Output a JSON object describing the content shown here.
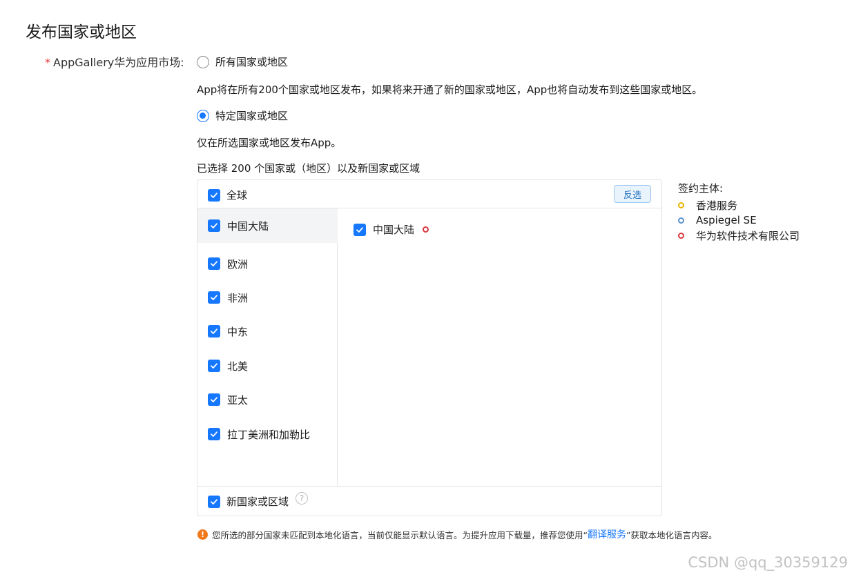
{
  "page": {
    "title": "发布国家或地区"
  },
  "field": {
    "required_mark": "*",
    "label": "AppGallery华为应用市场:"
  },
  "options": {
    "all_label": "所有国家或地区",
    "all_desc": "App将在所有200个国家或地区发布，如果将来开通了新的国家或地区，App也将自动发布到这些国家或地区。",
    "specific_label": "特定国家或地区",
    "specific_desc": "仅在所选国家或地区发布App。",
    "selected": "specific"
  },
  "summary": "已选择 200 个国家或（地区）以及新国家或区域",
  "panel": {
    "global_label": "全球",
    "invert_label": "反选",
    "regions": [
      {
        "label": "中国大陆",
        "checked": true,
        "active": true
      },
      {
        "label": "欧洲",
        "checked": true
      },
      {
        "label": "非洲",
        "checked": true
      },
      {
        "label": "中东",
        "checked": true
      },
      {
        "label": "北美",
        "checked": true
      },
      {
        "label": "亚太",
        "checked": true
      },
      {
        "label": "拉丁美洲和加勒比",
        "checked": true
      }
    ],
    "countries": [
      {
        "label": "中国大陆",
        "checked": true,
        "entity_color": "#d9363e"
      }
    ],
    "new_regions_label": "新国家或区域",
    "help_icon": "question-circle-icon"
  },
  "legend": {
    "title": "签约主体:",
    "items": [
      {
        "label": "香港服务",
        "color": "#e8b400"
      },
      {
        "label": "Aspiegel SE",
        "color": "#5b8fd1"
      },
      {
        "label": "华为软件技术有限公司",
        "color": "#d9363e"
      }
    ]
  },
  "notice": {
    "text_before": "您所选的部分国家未匹配到本地化语言，当前仅能显示默认语言。为提升应用下载量，推荐您使用“",
    "link": "翻译服务",
    "text_after": "”获取本地化语言内容。"
  },
  "watermark": "CSDN @qq_30359129",
  "colors": {
    "accent": "#1677ff",
    "warning": "#f2791b"
  }
}
